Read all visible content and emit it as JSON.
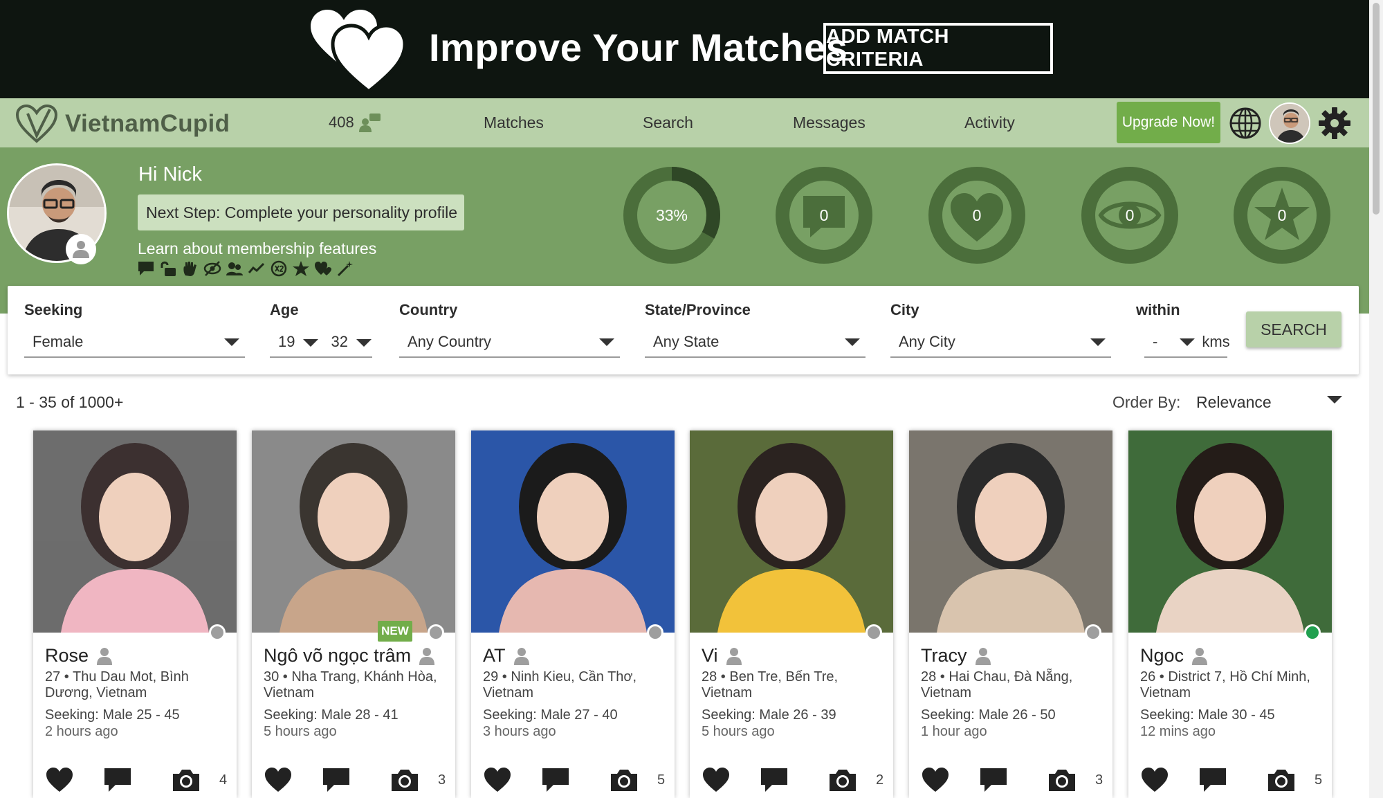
{
  "banner": {
    "title": "Improve Your Matches",
    "button_label": "ADD MATCH CRITERIA"
  },
  "nav": {
    "logo_text": "VietnamCupid",
    "count": "408",
    "links": [
      "Matches",
      "Search",
      "Messages",
      "Activity"
    ],
    "upgrade_label": "Upgrade Now!"
  },
  "profile": {
    "greeting": "Hi Nick",
    "next_step": "Next Step: Complete your personality profile",
    "learn": "Learn about membership features",
    "stats": [
      {
        "icon": "progress-ring",
        "value": "33%",
        "progress": 0.33
      },
      {
        "icon": "message-icon",
        "value": "0"
      },
      {
        "icon": "heart-icon",
        "value": "0"
      },
      {
        "icon": "eye-icon",
        "value": "0"
      },
      {
        "icon": "star-icon",
        "value": "0"
      }
    ]
  },
  "search": {
    "seeking_label": "Seeking",
    "seeking_value": "Female",
    "age_label": "Age",
    "age_min": "19",
    "age_max": "32",
    "country_label": "Country",
    "country_value": "Any Country",
    "state_label": "State/Province",
    "state_value": "Any State",
    "city_label": "City",
    "city_value": "Any City",
    "within_label": "within",
    "within_value": "-",
    "within_unit": "kms",
    "button_label": "SEARCH"
  },
  "results": {
    "count": "1 - 35 of 1000+",
    "order_label": "Order By:",
    "order_value": "Relevance"
  },
  "cards": [
    {
      "name": "Rose",
      "loc": "27 • Thu Dau Mot, Bình Dương, Vietnam",
      "seeking": "Seeking: Male 25 - 45",
      "time": "2 hours ago",
      "photos": "4",
      "online": false,
      "new": ""
    },
    {
      "name": "Ngô võ ngọc trâm",
      "loc": "30 • Nha Trang, Khánh Hòa, Vietnam",
      "seeking": "Seeking: Male 28 - 41",
      "time": "5 hours ago",
      "photos": "3",
      "online": false,
      "new": "NEW"
    },
    {
      "name": "AT",
      "loc": "29 • Ninh Kieu, Cần Thơ, Vietnam",
      "seeking": "Seeking: Male 27 - 40",
      "time": "3 hours ago",
      "photos": "5",
      "online": false,
      "new": ""
    },
    {
      "name": "Vi",
      "loc": "28 • Ben Tre, Bến Tre, Vietnam",
      "seeking": "Seeking: Male 26 - 39",
      "time": "5 hours ago",
      "photos": "2",
      "online": false,
      "new": ""
    },
    {
      "name": "Tracy",
      "loc": "28 • Hai Chau, Đà Nẵng, Vietnam",
      "seeking": "Seeking: Male 26 - 50",
      "time": "1 hour ago",
      "photos": "3",
      "online": false,
      "new": ""
    },
    {
      "name": "Ngoc",
      "loc": "26 • District 7, Hồ Chí Minh, Vietnam",
      "seeking": "Seeking: Male 30 - 45",
      "time": "12 mins ago",
      "photos": "5",
      "online": true,
      "new": ""
    }
  ],
  "colors": {
    "banner_bg": "#0e1510",
    "nav_bg": "#b8d1a9",
    "profile_bg": "#78a064",
    "accent_green": "#72ad4a",
    "online_dot": "#21a04f"
  }
}
